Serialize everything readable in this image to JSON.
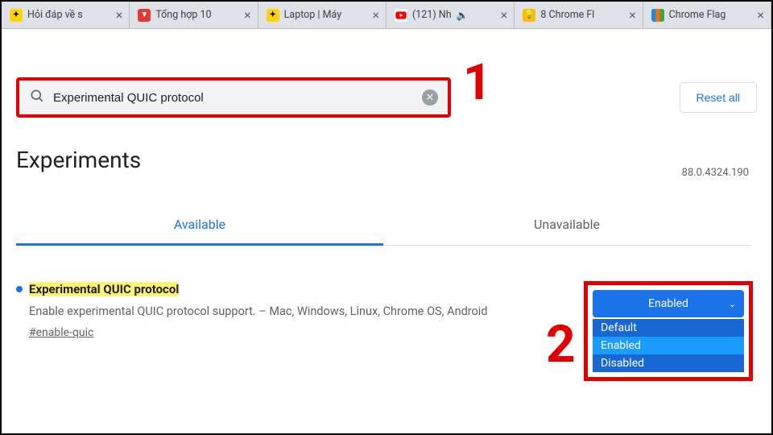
{
  "annotations": {
    "one": "1",
    "two": "2"
  },
  "tabs": [
    {
      "title": "Hỏi đáp về s",
      "fav": "tgd"
    },
    {
      "title": "Tổng hợp 10",
      "fav": "red"
    },
    {
      "title": "Laptop | Máy",
      "fav": "tgd"
    },
    {
      "title": "(121) Nh",
      "fav": "yt",
      "muted": true
    },
    {
      "title": "8 Chrome Fl",
      "fav": "bulb"
    },
    {
      "title": "Chrome Flag",
      "fav": "fpt"
    }
  ],
  "search": {
    "value": "Experimental QUIC protocol"
  },
  "reset_label": "Reset all",
  "page_title": "Experiments",
  "version": "88.0.4324.190",
  "section_tabs": {
    "available": "Available",
    "unavailable": "Unavailable"
  },
  "flag": {
    "title": "Experimental QUIC protocol",
    "desc": "Enable experimental QUIC protocol support. – Mac, Windows, Linux, Chrome OS, Android",
    "hash": "#enable-quic",
    "selected": "Enabled",
    "options": [
      "Default",
      "Enabled",
      "Disabled"
    ]
  }
}
